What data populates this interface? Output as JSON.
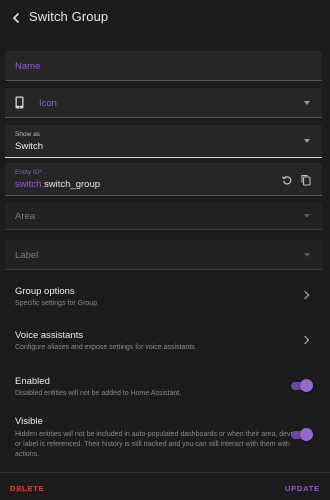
{
  "header": {
    "title": "Switch Group",
    "back_icon": "arrow-back-icon"
  },
  "fields": {
    "name": {
      "label": "Name"
    },
    "icon": {
      "label": "Icon",
      "icon": "cellphone-icon"
    },
    "show_as": {
      "label": "Show as",
      "value": "Switch"
    },
    "entity_id": {
      "label": "Entity ID*",
      "domain": "switch.",
      "object_id": "switch_group",
      "reset_icon": "restore-icon",
      "copy_icon": "copy-icon"
    },
    "area": {
      "label": "Area"
    },
    "label": {
      "label": "Label"
    }
  },
  "rows": {
    "group_options": {
      "title": "Group options",
      "subtitle": "Specific settings for Group"
    },
    "voice_assistants": {
      "title": "Voice assistants",
      "subtitle": "Configure aliases and expose settings for voice assistants"
    },
    "enabled": {
      "title": "Enabled",
      "subtitle": "Disabled entities will not be added to Home Assistant.",
      "on": true
    },
    "visible": {
      "title": "Visible",
      "subtitle": "Hidden entities will not be included in auto-populated dashboards or when their area, device or label is referenced. Their history is still tracked and you can still interact with them with actions.",
      "on": true
    }
  },
  "footer": {
    "delete_label": "DELETE",
    "update_label": "UPDATE"
  },
  "colors": {
    "accent": "#8d5fc9",
    "danger": "#e0444a",
    "background": "#1c1c1c",
    "field_bg": "#262626"
  }
}
